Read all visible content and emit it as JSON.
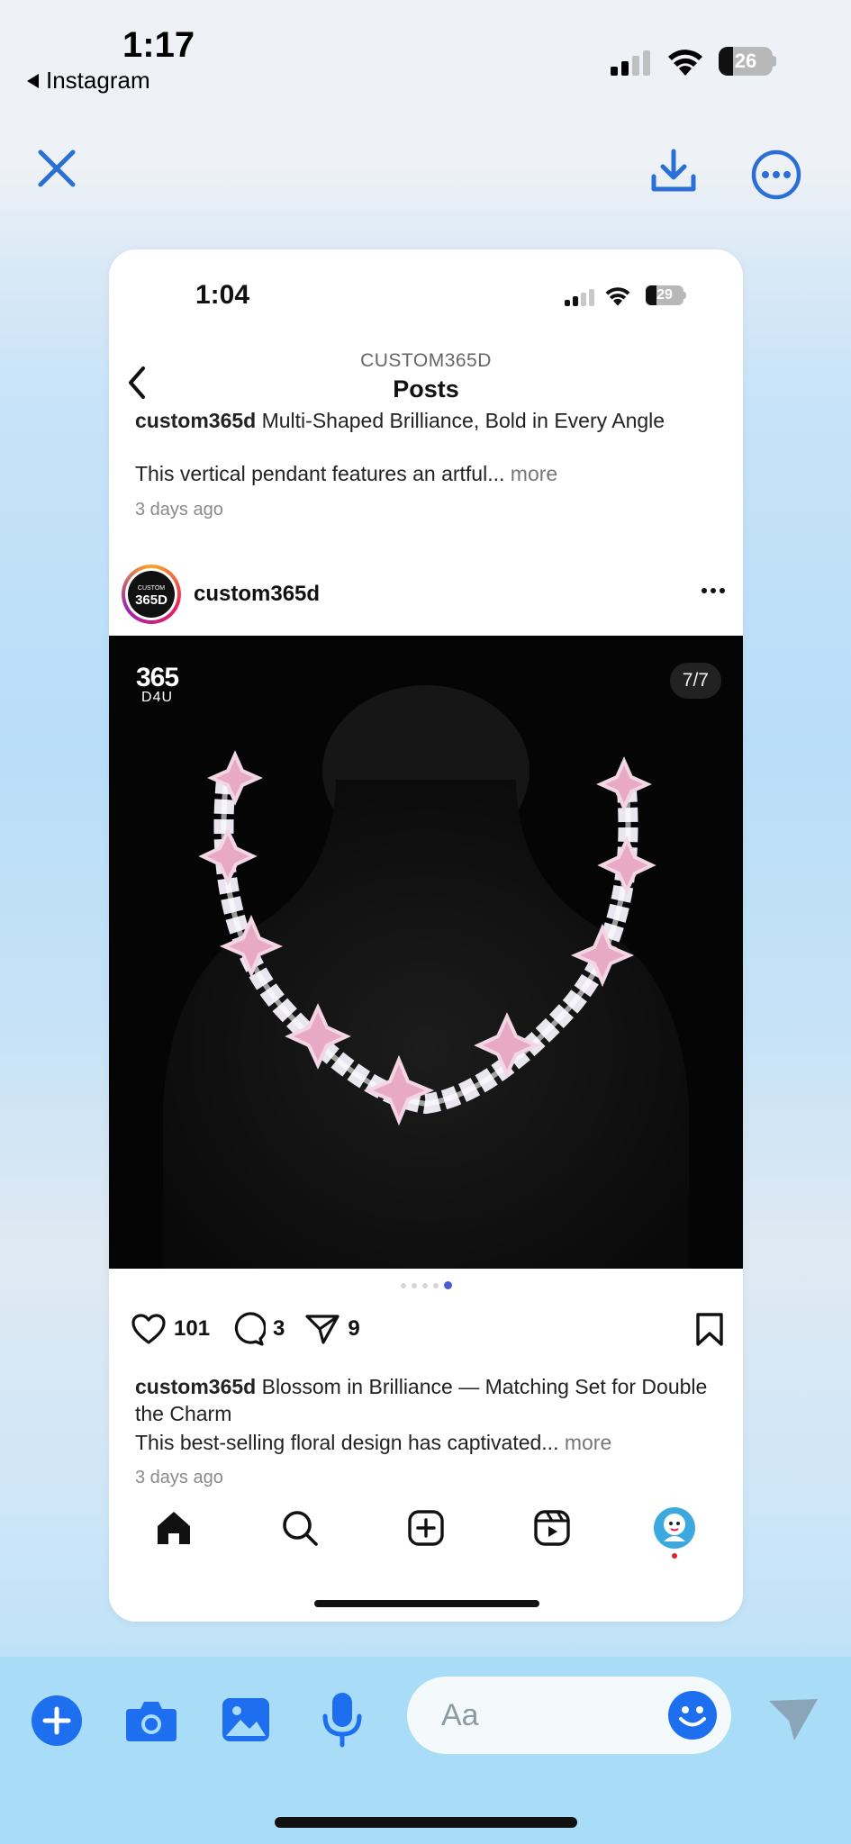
{
  "outer_status": {
    "time": "1:17",
    "back_app": "Instagram",
    "battery": "26"
  },
  "inner_status": {
    "time": "1:04",
    "battery": "29"
  },
  "header": {
    "account": "CUSTOM365D",
    "title": "Posts"
  },
  "prev_post": {
    "username": "custom365d",
    "title": "Multi-Shaped Brilliance, Bold in Every Angle",
    "snippet": "This vertical pendant features an artful...",
    "more": "more",
    "time_ago": "3 days ago"
  },
  "post": {
    "username": "custom365d",
    "avatar_text": "365D",
    "avatar_small": "CUSTOM",
    "watermark_big": "365",
    "watermark_small": "D4U",
    "counter": "7/7",
    "likes": "101",
    "comments": "3",
    "shares": "9",
    "caption_title": "Blossom in Brilliance — Matching Set for Double the Charm",
    "snippet": "This best-selling floral design has captivated...",
    "more": "more",
    "time_ago": "3 days ago",
    "page_dots": 5,
    "active_dot": 5
  },
  "message_bar": {
    "placeholder": "Aa"
  },
  "colors": {
    "accent_blue": "#1e6ff0",
    "icon_blue": "#2a6fd6",
    "message_bar_bg": "#a9dcf6"
  },
  "icons": [
    "close-icon",
    "download-icon",
    "more-icon",
    "back-icon",
    "heart-icon",
    "comment-icon",
    "share-icon",
    "bookmark-icon",
    "home-icon",
    "search-icon",
    "create-icon",
    "reels-icon",
    "profile-icon",
    "plus-icon",
    "camera-icon",
    "gallery-icon",
    "mic-icon",
    "emoji-icon",
    "send-icon"
  ]
}
